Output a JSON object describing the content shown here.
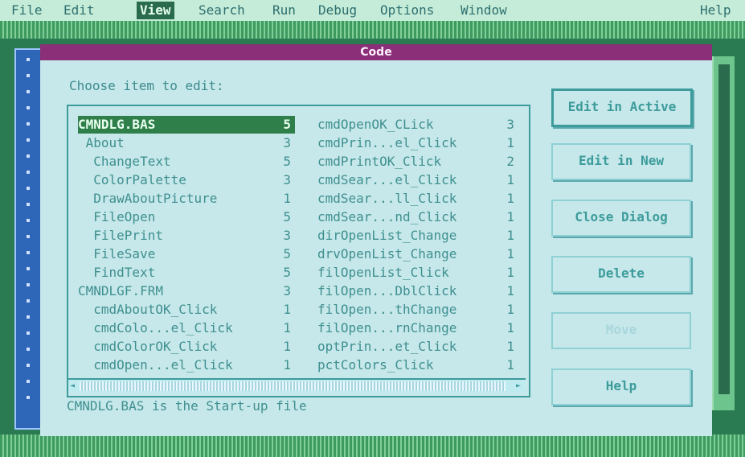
{
  "menu": {
    "items": [
      {
        "label": "File"
      },
      {
        "label": "Edit"
      },
      {
        "label": "View"
      },
      {
        "label": "Search"
      },
      {
        "label": "Run"
      },
      {
        "label": "Debug"
      },
      {
        "label": "Options"
      },
      {
        "label": "Window"
      },
      {
        "label": "Help"
      }
    ],
    "active_index": 2
  },
  "dialog": {
    "title": "Code",
    "prompt": "Choose item to edit:",
    "footer": "CMNDLG.BAS is the Start-up file",
    "list_col1": [
      {
        "name": "CMNDLG.BAS",
        "count": "5"
      },
      {
        "name": " About",
        "count": "3"
      },
      {
        "name": "  ChangeText",
        "count": "5"
      },
      {
        "name": "  ColorPalette",
        "count": "3"
      },
      {
        "name": "  DrawAboutPicture",
        "count": "1"
      },
      {
        "name": "  FileOpen",
        "count": "5"
      },
      {
        "name": "  FilePrint",
        "count": "3"
      },
      {
        "name": "  FileSave",
        "count": "5"
      },
      {
        "name": "  FindText",
        "count": "5"
      },
      {
        "name": "CMNDLGF.FRM",
        "count": "3"
      },
      {
        "name": "  cmdAboutOK_Click",
        "count": "1"
      },
      {
        "name": "  cmdColo...el_Click",
        "count": "1"
      },
      {
        "name": "  cmdColorOK_Click",
        "count": "1"
      },
      {
        "name": "  cmdOpen...el_Click",
        "count": "1"
      }
    ],
    "list_col2": [
      {
        "name": "cmdOpenOK_CLick",
        "count": "3"
      },
      {
        "name": "cmdPrin...el_Click",
        "count": "1"
      },
      {
        "name": "cmdPrintOK_Click",
        "count": "2"
      },
      {
        "name": "cmdSear...el_Click",
        "count": "1"
      },
      {
        "name": "cmdSear...ll_Click",
        "count": "1"
      },
      {
        "name": "cmdSear...nd_Click",
        "count": "1"
      },
      {
        "name": "dirOpenList_Change",
        "count": "1"
      },
      {
        "name": "drvOpenList_Change",
        "count": "1"
      },
      {
        "name": "filOpenList_Click",
        "count": "1"
      },
      {
        "name": "filOpen...DblClick",
        "count": "1"
      },
      {
        "name": "filOpen...thChange",
        "count": "1"
      },
      {
        "name": "filOpen...rnChange",
        "count": "1"
      },
      {
        "name": "optPrin...et_Click",
        "count": "1"
      },
      {
        "name": "pctColors_Click",
        "count": "1"
      }
    ],
    "buttons": [
      {
        "label": "Edit in Active"
      },
      {
        "label": "Edit in New"
      },
      {
        "label": "Close Dialog"
      },
      {
        "label": "Delete"
      },
      {
        "label": "Move"
      },
      {
        "label": "Help"
      }
    ]
  }
}
